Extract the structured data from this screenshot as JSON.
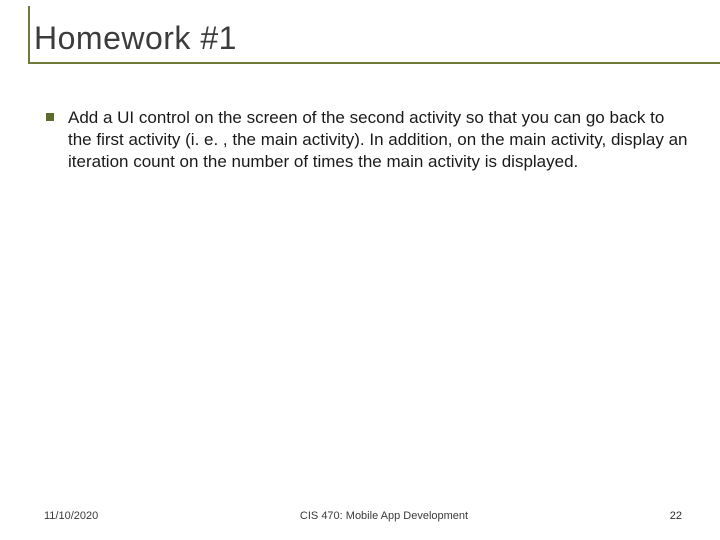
{
  "slide": {
    "title": "Homework #1",
    "bullets": [
      {
        "text": "Add a UI control on the screen of the second activity so that you can go back to the first activity (i. e. , the main activity). In addition, on the main activity, display an iteration count on the number of times the main activity is displayed."
      }
    ],
    "footer": {
      "date": "11/10/2020",
      "center": "CIS 470: Mobile App Development",
      "page": "22"
    }
  }
}
